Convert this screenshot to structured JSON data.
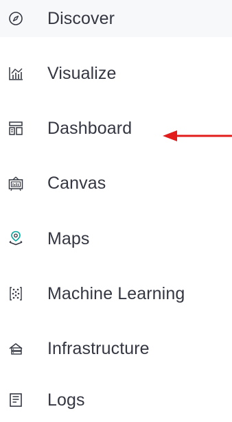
{
  "nav": {
    "items": [
      {
        "label": "Discover",
        "icon": "compass-icon"
      },
      {
        "label": "Visualize",
        "icon": "visualize-icon"
      },
      {
        "label": "Dashboard",
        "icon": "dashboard-icon"
      },
      {
        "label": "Canvas",
        "icon": "canvas-icon"
      },
      {
        "label": "Maps",
        "icon": "map-pin-icon"
      },
      {
        "label": "Machine Learning",
        "icon": "machine-learning-icon"
      },
      {
        "label": "Infrastructure",
        "icon": "infrastructure-icon"
      },
      {
        "label": "Logs",
        "icon": "logs-icon"
      }
    ]
  },
  "colors": {
    "text": "#343741",
    "icon": "#343741",
    "pin_icon": "#00a69b",
    "highlight_bg": "#f7f8fa",
    "annotation_arrow": "#e21b1b"
  }
}
